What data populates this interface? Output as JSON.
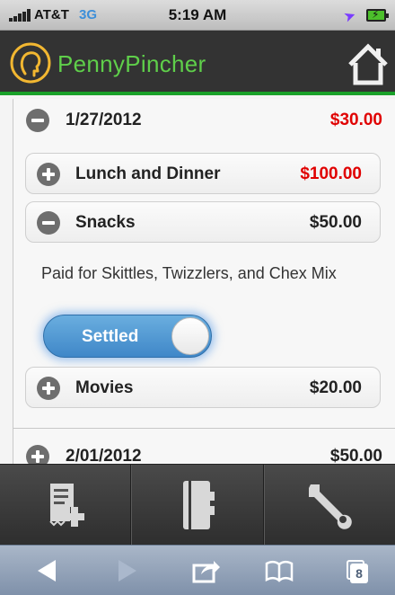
{
  "status_bar": {
    "carrier": "AT&T",
    "network": "3G",
    "time": "5:19 AM"
  },
  "header": {
    "app_title": "PennyPincher",
    "logo_icon": "person-head-icon",
    "home_icon": "home-icon"
  },
  "expenses": {
    "date_groups": [
      {
        "date": "1/27/2012",
        "total": "$30.00",
        "total_color": "#e00000",
        "state": "expanded"
      },
      {
        "date": "2/01/2012",
        "total": "$50.00",
        "state": "collapsed"
      }
    ],
    "items": [
      {
        "label": "Lunch and Dinner",
        "amount": "$100.00",
        "amount_color": "#e00000",
        "state": "collapsed"
      },
      {
        "label": "Snacks",
        "amount": "$50.00",
        "state": "expanded",
        "note": "Paid for Skittles, Twizzlers, and Chex Mix",
        "switch_label": "Settled",
        "switch_on": true
      },
      {
        "label": "Movies",
        "amount": "$20.00",
        "state": "collapsed"
      }
    ]
  },
  "tab_bar": {
    "tabs": [
      {
        "icon": "add-receipt-icon"
      },
      {
        "icon": "notebook-icon"
      },
      {
        "icon": "wrench-icon"
      }
    ]
  },
  "browser_toolbar": {
    "tab_count": "8",
    "icons": [
      "back-icon",
      "forward-icon",
      "share-icon",
      "bookmarks-icon",
      "tabs-icon"
    ]
  },
  "colors": {
    "accent_green": "#1aa12a",
    "header_bg": "#333333",
    "negative_red": "#e00000",
    "switch_blue": "#4f96d3"
  }
}
